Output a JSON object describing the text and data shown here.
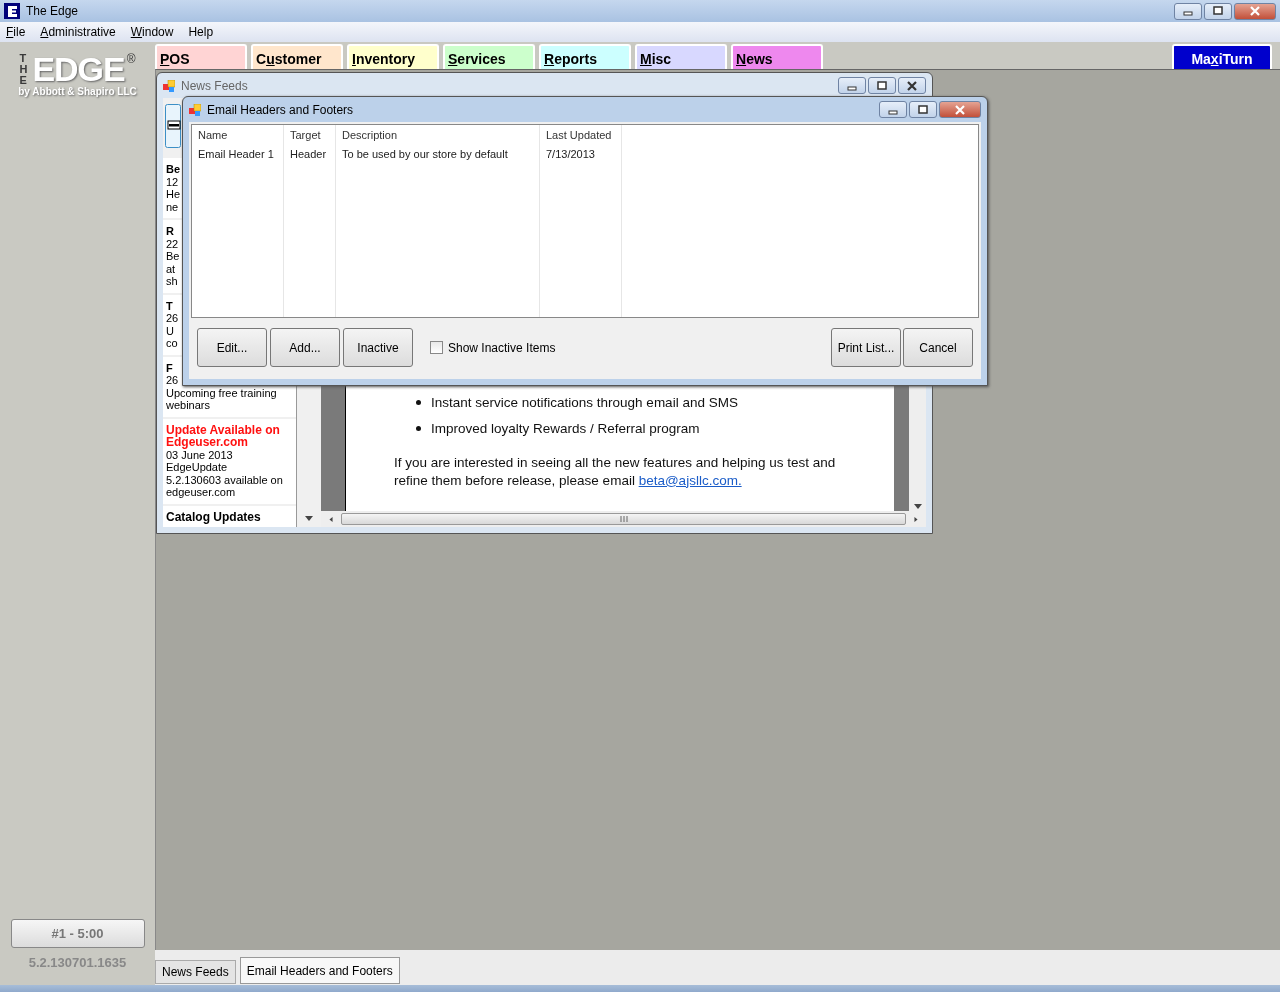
{
  "window": {
    "title": "The Edge"
  },
  "menu": [
    {
      "accel": "F",
      "after": "ile"
    },
    {
      "accel": "A",
      "after": "dministrative"
    },
    {
      "accel": "W",
      "after": "indow"
    },
    {
      "label": "Help"
    }
  ],
  "logo": {
    "top": "THE",
    "main": "EDGE",
    "mark": "®",
    "sub": "by Abbott & Shapiro LLC"
  },
  "module_tabs": [
    {
      "accel": "P",
      "after": "OS",
      "color": "#ffd4d4"
    },
    {
      "before": "C",
      "accel": "u",
      "after": "stomer",
      "color": "#ffe6cc"
    },
    {
      "accel": "I",
      "after": "nventory",
      "color": "#ffffcc"
    },
    {
      "accel": "S",
      "after": "ervices",
      "color": "#ccffcc"
    },
    {
      "accel": "R",
      "after": "eports",
      "color": "#ccffff"
    },
    {
      "accel": "M",
      "after": "isc",
      "color": "#d8d8ff"
    },
    {
      "accel": "N",
      "after": "ews",
      "color": "#ee88ee"
    }
  ],
  "maxiturn": {
    "before": "Ma",
    "accel": "x",
    "after": "iTurn"
  },
  "news_window": {
    "title": "News Feeds",
    "items": [
      {
        "lines": [
          "Be",
          "12",
          "He",
          "ne"
        ]
      },
      {
        "lines": [
          "R",
          "22",
          "Be",
          "at",
          "sh"
        ]
      },
      {
        "lines": [
          "T",
          "26",
          "U",
          "co"
        ]
      },
      {
        "lines": [
          "F",
          "26",
          "Upcoming free training",
          "webinars"
        ]
      },
      {
        "alert": true,
        "title": "Update Available on Edgeuser.com",
        "lines": [
          "03 June 2013",
          "EdgeUpdate",
          "5.2.130603 available on",
          "edgeuser.com"
        ]
      },
      {
        "title": "Catalog Updates"
      }
    ],
    "bullets": [
      "Instant service notifications through email and SMS",
      "Improved loyalty Rewards / Referral program"
    ],
    "paragraph": "If you are interested in seeing all the new features and helping us test and refine them before release, please email ",
    "link": "beta@ajsllc.com."
  },
  "dialog": {
    "title": "Email Headers and Footers",
    "columns": [
      "Name",
      "Target",
      "Description",
      "Last Updated"
    ],
    "rows": [
      [
        "Email Header 1",
        "Header",
        "To be used by our store by default",
        "7/13/2013"
      ]
    ],
    "left_buttons": [
      "Edit...",
      "Add...",
      "Inactive"
    ],
    "checkbox": {
      "label": "Show Inactive Items",
      "checked": false
    },
    "right_buttons": [
      "Print List...",
      "Cancel"
    ]
  },
  "station": {
    "button": "#1 - 5:00",
    "version": "5.2.130701.1635"
  },
  "window_tabs": [
    {
      "label": "News Feeds",
      "selected": false
    },
    {
      "label": "Email Headers and Footers",
      "selected": true
    }
  ]
}
